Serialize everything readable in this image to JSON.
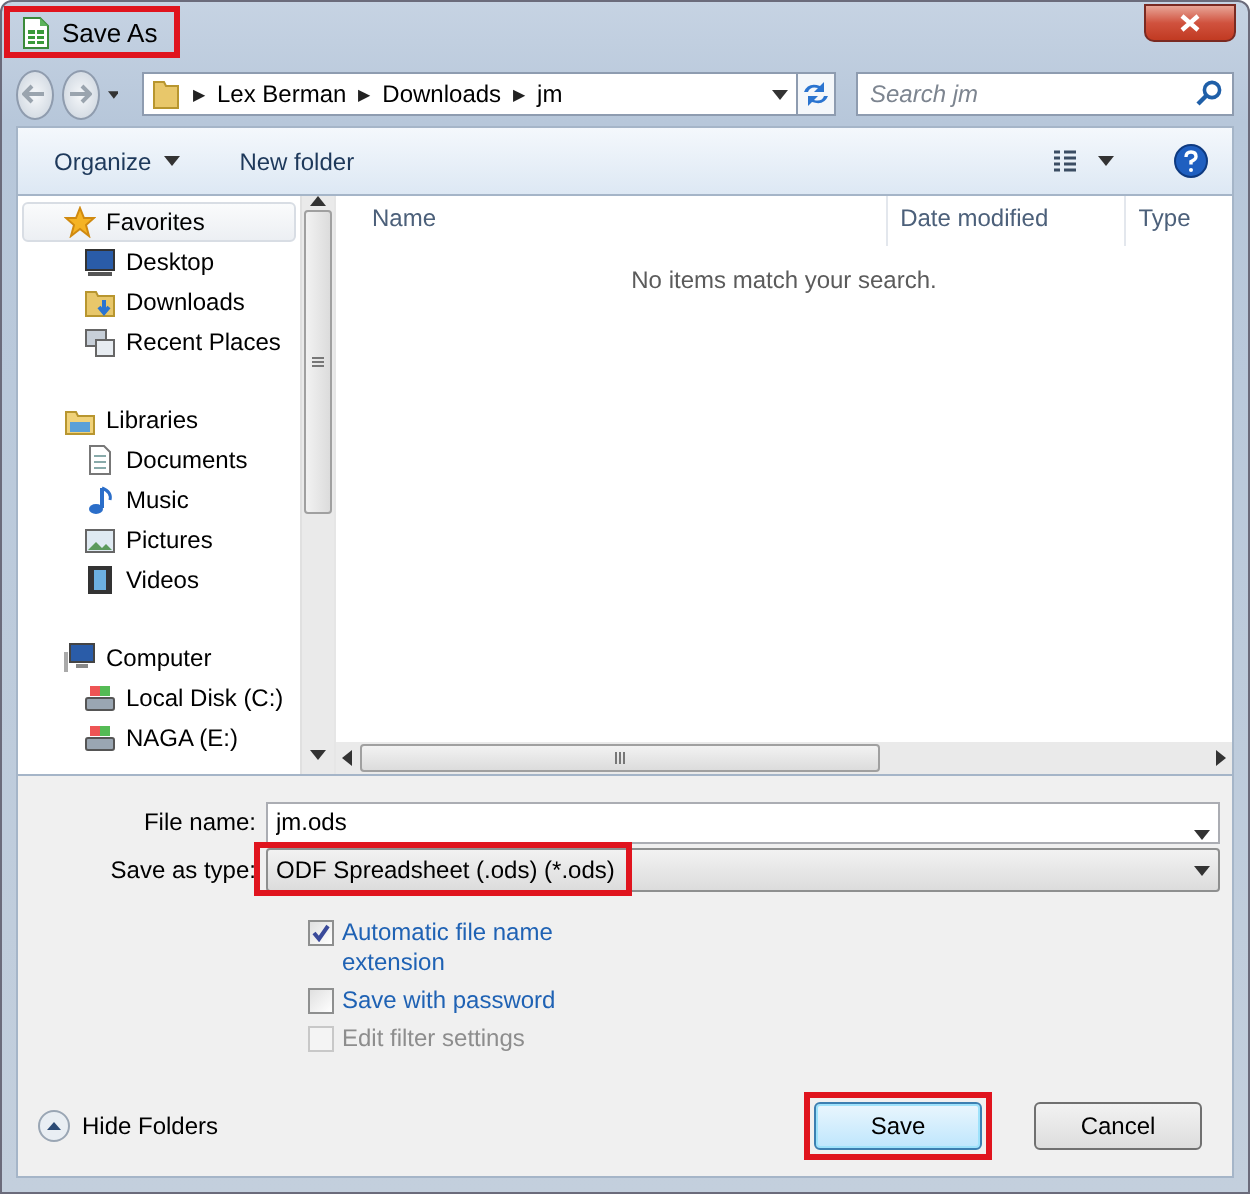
{
  "window": {
    "title": "Save As",
    "title_highlighted": true
  },
  "address": {
    "crumbs": [
      "Lex Berman",
      "Downloads",
      "jm"
    ],
    "separator": "▶"
  },
  "search": {
    "placeholder": "Search jm"
  },
  "toolbar": {
    "organize": "Organize",
    "new_folder": "New folder"
  },
  "nav": [
    {
      "label": "Favorites",
      "selected": true,
      "children": [
        {
          "label": "Desktop",
          "selected": false
        },
        {
          "label": "Downloads",
          "selected": false
        },
        {
          "label": "Recent Places",
          "selected": false
        }
      ]
    },
    {
      "label": "Libraries",
      "selected": false,
      "children": [
        {
          "label": "Documents",
          "selected": false
        },
        {
          "label": "Music",
          "selected": false
        },
        {
          "label": "Pictures",
          "selected": false
        },
        {
          "label": "Videos",
          "selected": false
        }
      ]
    },
    {
      "label": "Computer",
      "selected": false,
      "children": [
        {
          "label": "Local Disk (C:)",
          "selected": false
        },
        {
          "label": "NAGA (E:)",
          "selected": false
        }
      ]
    }
  ],
  "file_list": {
    "columns": [
      "Name",
      "Date modified",
      "Type"
    ],
    "empty_message": "No items match your search."
  },
  "form": {
    "file_name": {
      "label": "File name:",
      "value": "jm.ods"
    },
    "save_as_type": {
      "label": "Save as type:",
      "value": "ODF Spreadsheet (.ods) (*.ods)",
      "highlighted": true
    }
  },
  "options": [
    {
      "label": "Automatic file name extension",
      "checked": true,
      "disabled": false
    },
    {
      "label": "Save with password",
      "checked": false,
      "disabled": false
    },
    {
      "label": "Edit filter settings",
      "checked": false,
      "disabled": true
    }
  ],
  "hide_folders": "Hide Folders",
  "buttons": [
    {
      "label": "Save",
      "kind": "primary",
      "highlighted": true
    },
    {
      "label": "Cancel",
      "kind": "secondary",
      "highlighted": false
    }
  ]
}
